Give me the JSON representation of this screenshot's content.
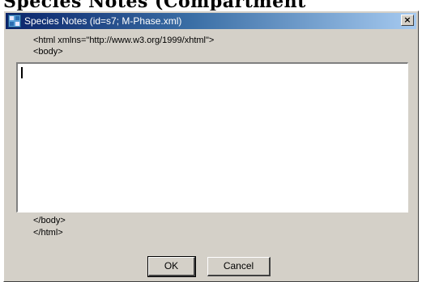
{
  "top_strip_text": "Species Notes (Compartment",
  "dialog": {
    "title": "Species Notes (id=s7; M-Phase.xml)",
    "close_glyph": "×"
  },
  "code_before": [
    "<html xmlns=\"http://www.w3.org/1999/xhtml\">",
    "<body>"
  ],
  "editor": {
    "value": ""
  },
  "code_after": [
    "</body>",
    "</html>"
  ],
  "buttons": {
    "ok_label": "OK",
    "cancel_label": "Cancel"
  },
  "colors": {
    "dialog_face": "#d4d0c8",
    "title_active": "#0a246a",
    "title_gradient_end": "#a6caf0"
  },
  "icons": {
    "app": "app-icon",
    "close": "close-icon"
  }
}
